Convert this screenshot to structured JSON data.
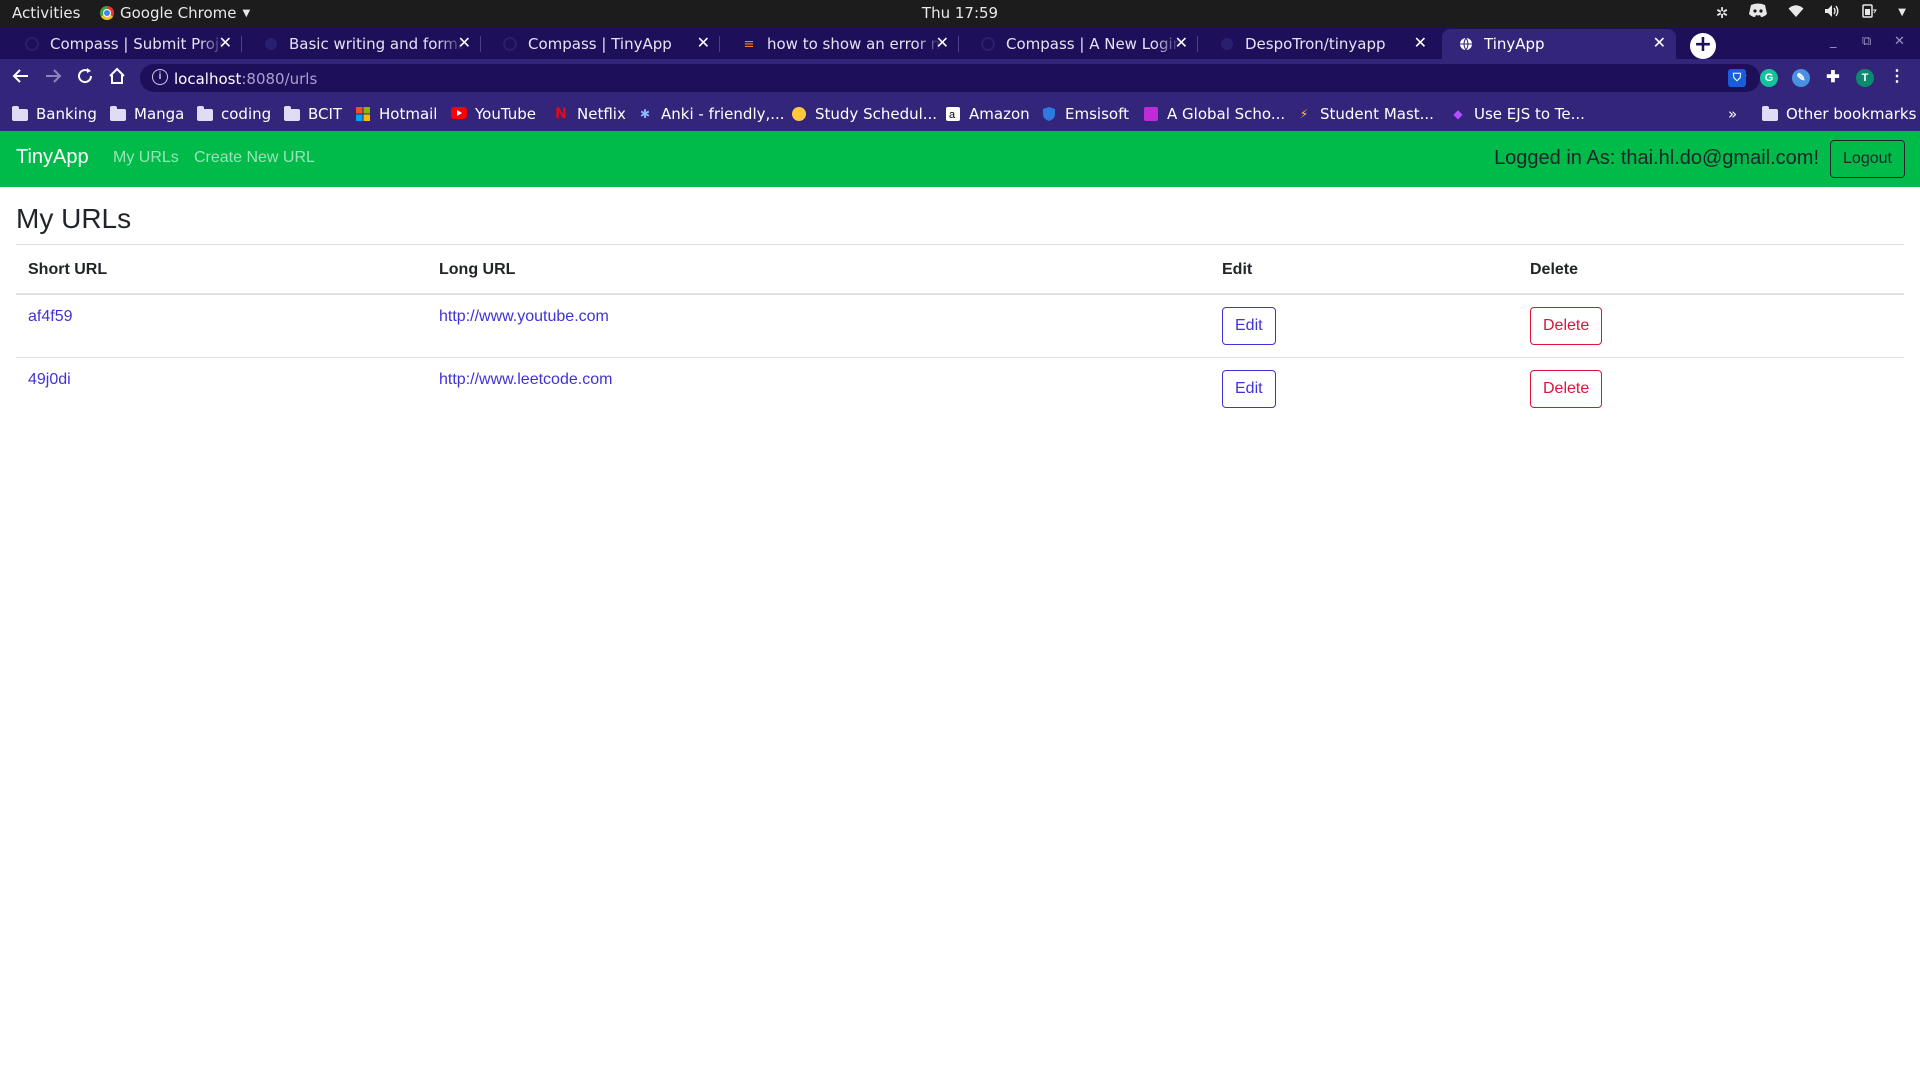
{
  "os": {
    "activities": "Activities",
    "app_name": "Google Chrome",
    "clock": "Thu 17:59"
  },
  "browser": {
    "tabs": [
      {
        "title": "Compass | Submit Project",
        "active": false
      },
      {
        "title": "Basic writing and formatting",
        "active": false
      },
      {
        "title": "Compass | TinyApp",
        "active": false
      },
      {
        "title": "how to show an error message",
        "active": false
      },
      {
        "title": "Compass | A New Login Page",
        "active": false
      },
      {
        "title": "DespoTron/tinyapp",
        "active": false
      },
      {
        "title": "TinyApp",
        "active": true
      }
    ],
    "url_host": "localhost",
    "url_rest": ":8080/urls",
    "extension_profile": "T",
    "bookmarks": [
      {
        "label": "Banking",
        "icon": "folder-icon"
      },
      {
        "label": "Manga",
        "icon": "folder-icon"
      },
      {
        "label": "coding",
        "icon": "folder-icon"
      },
      {
        "label": "BCIT",
        "icon": "folder-icon"
      },
      {
        "label": "Hotmail",
        "icon": "microsoft-icon"
      },
      {
        "label": "YouTube",
        "icon": "youtube-icon"
      },
      {
        "label": "Netflix",
        "icon": "netflix-icon"
      },
      {
        "label": "Anki - friendly,...",
        "icon": "anki-icon"
      },
      {
        "label": "Study Schedul...",
        "icon": "emoji-icon"
      },
      {
        "label": "Amazon",
        "icon": "amazon-icon"
      },
      {
        "label": "Emsisoft",
        "icon": "shield-icon"
      },
      {
        "label": "A Global Scho...",
        "icon": "school-icon"
      },
      {
        "label": "Student Mast...",
        "icon": "student-icon"
      },
      {
        "label": "Use EJS to Te...",
        "icon": "ejs-icon"
      }
    ],
    "overflow": "»",
    "other_bookmarks": "Other bookmarks"
  },
  "app": {
    "brand": "TinyApp",
    "nav": {
      "my_urls": "My URLs",
      "create_new": "Create New URL"
    },
    "logged_in": "Logged in As: thai.hl.do@gmail.com!",
    "logout": "Logout",
    "colors": {
      "navbar": "#00bb4a",
      "link": "#3f32d8",
      "danger": "#dc143c"
    }
  },
  "main": {
    "heading": "My URLs",
    "columns": [
      "Short URL",
      "Long URL",
      "Edit",
      "Delete"
    ],
    "rows": [
      {
        "short": "af4f59",
        "long": "http://www.youtube.com",
        "edit": "Edit",
        "delete": "Delete"
      },
      {
        "short": "49j0di",
        "long": "http://www.leetcode.com",
        "edit": "Edit",
        "delete": "Delete"
      }
    ]
  }
}
